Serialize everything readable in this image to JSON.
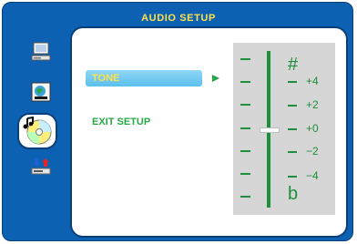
{
  "header": {
    "title": "AUDIO SETUP"
  },
  "sidebar": {
    "icons": [
      {
        "name": "computer-icon"
      },
      {
        "name": "language-icon"
      },
      {
        "name": "audio-disc-icon",
        "selected": true
      },
      {
        "name": "preference-icon"
      }
    ]
  },
  "menu": {
    "items": [
      {
        "label": "TONE",
        "selected": true
      },
      {
        "label": "EXIT SETUP",
        "selected": false
      }
    ]
  },
  "tone_scale": {
    "sharp_symbol": "#",
    "flat_symbol": "b",
    "levels": [
      "+4",
      "+2",
      "+0",
      "−2",
      "−4"
    ],
    "current_level": "+0"
  },
  "colors": {
    "frame_blue": "#0c61b2",
    "header_yellow": "#ffe24a",
    "accent_green": "#27a845",
    "highlight_cyan": "#5cc0ee",
    "scale_gray": "#d6d6d6"
  }
}
